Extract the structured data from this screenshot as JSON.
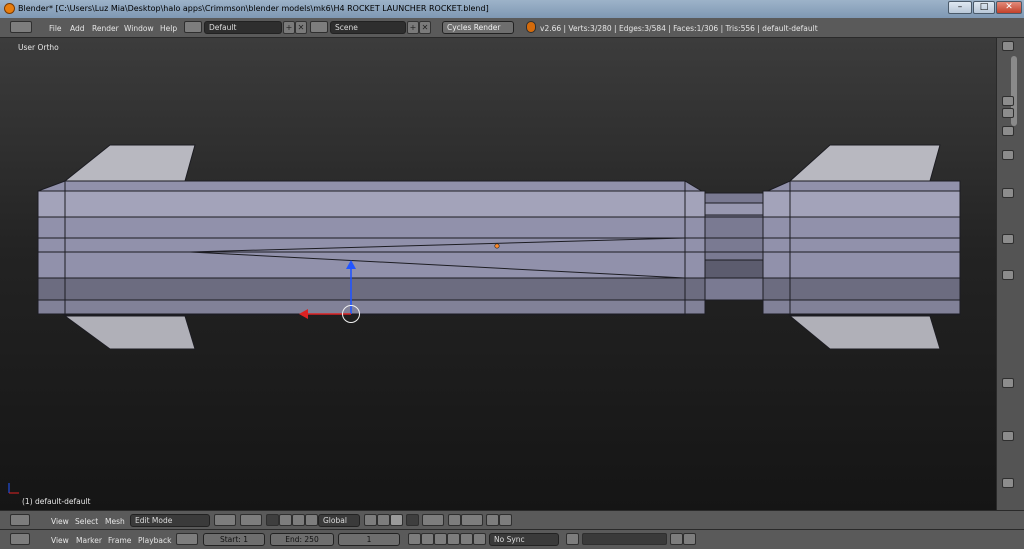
{
  "window": {
    "title": "Blender* [C:\\Users\\Luz Mia\\Desktop\\halo apps\\Crimmson\\blender models\\mk6\\H4 ROCKET LAUNCHER ROCKET.blend]",
    "minimize": "–",
    "maximize": "□",
    "close": "✕"
  },
  "info_header": {
    "menus": [
      "File",
      "Add",
      "Render",
      "Window",
      "Help"
    ],
    "screen_layout": "Default",
    "scene": "Scene",
    "render_engine": "Cycles Render",
    "stats": "v2.66 | Verts:3/280 | Edges:3/584 | Faces:1/306 | Tris:556 | default-default",
    "add_symbol": "+",
    "remove_symbol": "✕"
  },
  "viewport": {
    "view_label": "User Ortho",
    "object_label": "(1) default-default"
  },
  "view3d_header": {
    "menus": [
      "View",
      "Select",
      "Mesh"
    ],
    "mode": "Edit Mode",
    "orientation": "Global"
  },
  "timeline_header": {
    "menus": [
      "View",
      "Marker",
      "Frame",
      "Playback"
    ],
    "start": "Start: 1",
    "end": "End: 250",
    "current_frame": "1",
    "sync": "No Sync"
  },
  "colors": {
    "mesh_fill": "#8c8ca8",
    "mesh_shadow": "#5f5f70",
    "mesh_edge": "#1c1c22",
    "gizmo_y": "#2255ff",
    "gizmo_x": "#dd2222"
  }
}
